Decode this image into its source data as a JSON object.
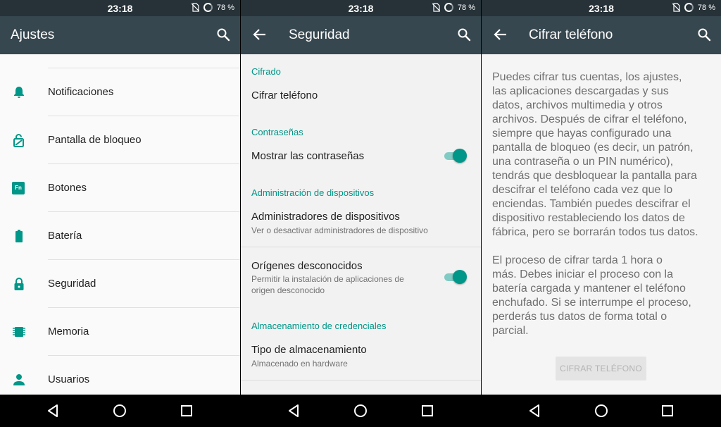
{
  "status": {
    "time": "23:18",
    "battery": "78 %"
  },
  "pane1": {
    "title": "Ajustes",
    "items": [
      {
        "label": "Notificaciones",
        "icon": "bell-icon"
      },
      {
        "label": "Pantalla de bloqueo",
        "icon": "lock-screen-icon"
      },
      {
        "label": "Botones",
        "icon": "fn-button-icon"
      },
      {
        "label": "Batería",
        "icon": "battery-icon"
      },
      {
        "label": "Seguridad",
        "icon": "lock-icon"
      },
      {
        "label": "Memoria",
        "icon": "memory-chip-icon"
      },
      {
        "label": "Usuarios",
        "icon": "person-icon"
      }
    ],
    "fn_badge": "Fn"
  },
  "pane2": {
    "title": "Seguridad",
    "cat_cifrado": "Cifrado",
    "cifrar_telefono": "Cifrar teléfono",
    "cat_contrasenas": "Contraseñas",
    "mostrar_contrasenas": "Mostrar las contraseñas",
    "mostrar_contrasenas_on": true,
    "cat_admin": "Administración de dispositivos",
    "admin_title": "Administradores de dispositivos",
    "admin_sub": "Ver o desactivar administradores de dispositivo",
    "origenes_title": "Orígenes desconocidos",
    "origenes_sub_1": "Permitir la instalación de aplicaciones de",
    "origenes_sub_2": "origen desconocido",
    "origenes_on": true,
    "cat_credenciales": "Almacenamiento de credenciales",
    "tipo_title": "Tipo de almacenamiento",
    "tipo_sub": "Almacenado en hardware"
  },
  "pane3": {
    "title": "Cifrar teléfono",
    "para1": "Puedes cifrar tus cuentas, los ajustes,\nlas aplicaciones descargadas y sus\ndatos, archivos multimedia y otros\narchivos. Después de cifrar el teléfono,\nsiempre que hayas configurado una\npantalla de bloqueo (es decir, un patrón,\nuna contraseña o un PIN numérico),\ntendrás que desbloquear la pantalla para\ndescifrar el teléfono cada vez que lo\nenciendas. También puedes descifrar el\ndispositivo restableciendo los datos de\nfábrica, pero se borrarán todos tus datos.",
    "para2": "El proceso de cifrar tarda 1 hora o\nmás. Debes iniciar el proceso con la\nbatería cargada y mantener el teléfono\nenchufado. Si se interrumpe el proceso,\nperderás tus datos de forma total o\nparcial.",
    "button": "CIFRAR TELÉFONO"
  },
  "colors": {
    "accent": "#009688",
    "appbar": "#37474f",
    "statusbar": "#263238"
  }
}
